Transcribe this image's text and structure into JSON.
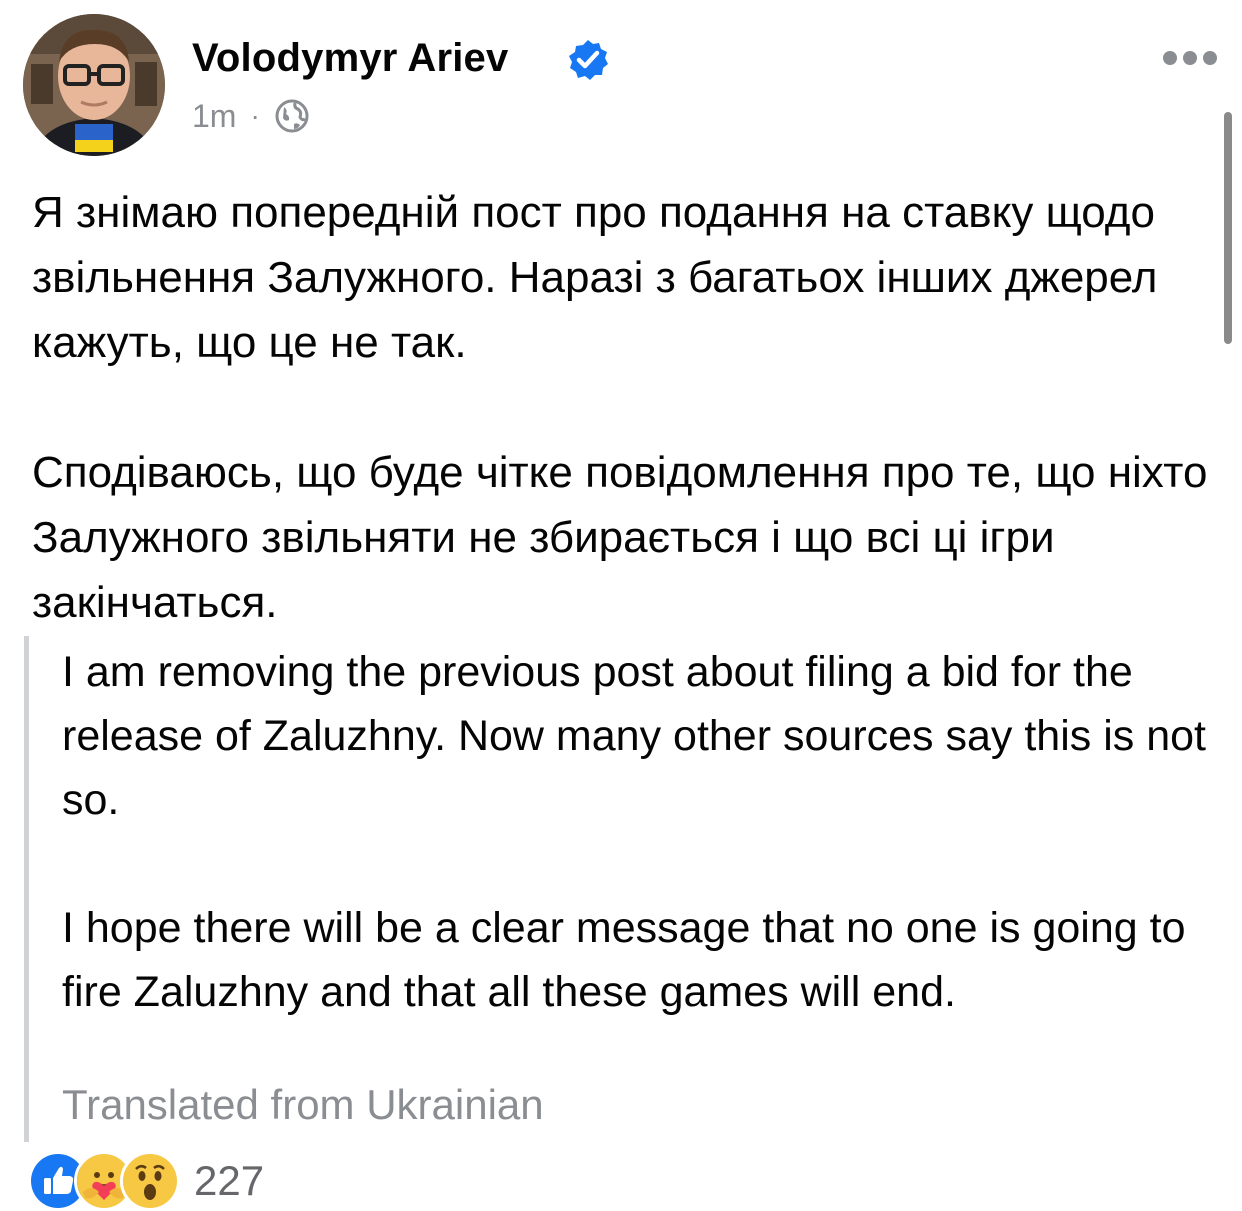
{
  "post": {
    "author": "Volodymyr Ariev",
    "time": "1m",
    "separator": "·",
    "audience_icon": "globe-icon",
    "verified_icon": "verified-badge-icon",
    "more_icon": "more-horizontal-icon",
    "text_paragraphs": [
      "Я знімаю попередній пост про подання на ставку щодо звільнення Залужного. Наразі з багатьох інших джерел кажуть, що це не так.",
      "Сподіваюсь, що буде чітке повідомлення про те, що ніхто Залужного звільняти не збирається і що всі ці ігри закінчаться."
    ],
    "translation_paragraphs": [
      "I am removing the previous post about filing a bid for the release of Zaluzhny. Now many other sources say this is not so.",
      "I hope there will be a clear message that no one is going to fire Zaluzhny and that all these games will end."
    ],
    "translated_note": "Translated from Ukrainian"
  },
  "reactions": {
    "icons": [
      "like-icon",
      "care-icon",
      "wow-icon"
    ],
    "count": "227"
  },
  "colors": {
    "verified_blue": "#1877f2",
    "muted_text": "#8a8d91",
    "quote_border": "#d0d2d6"
  }
}
